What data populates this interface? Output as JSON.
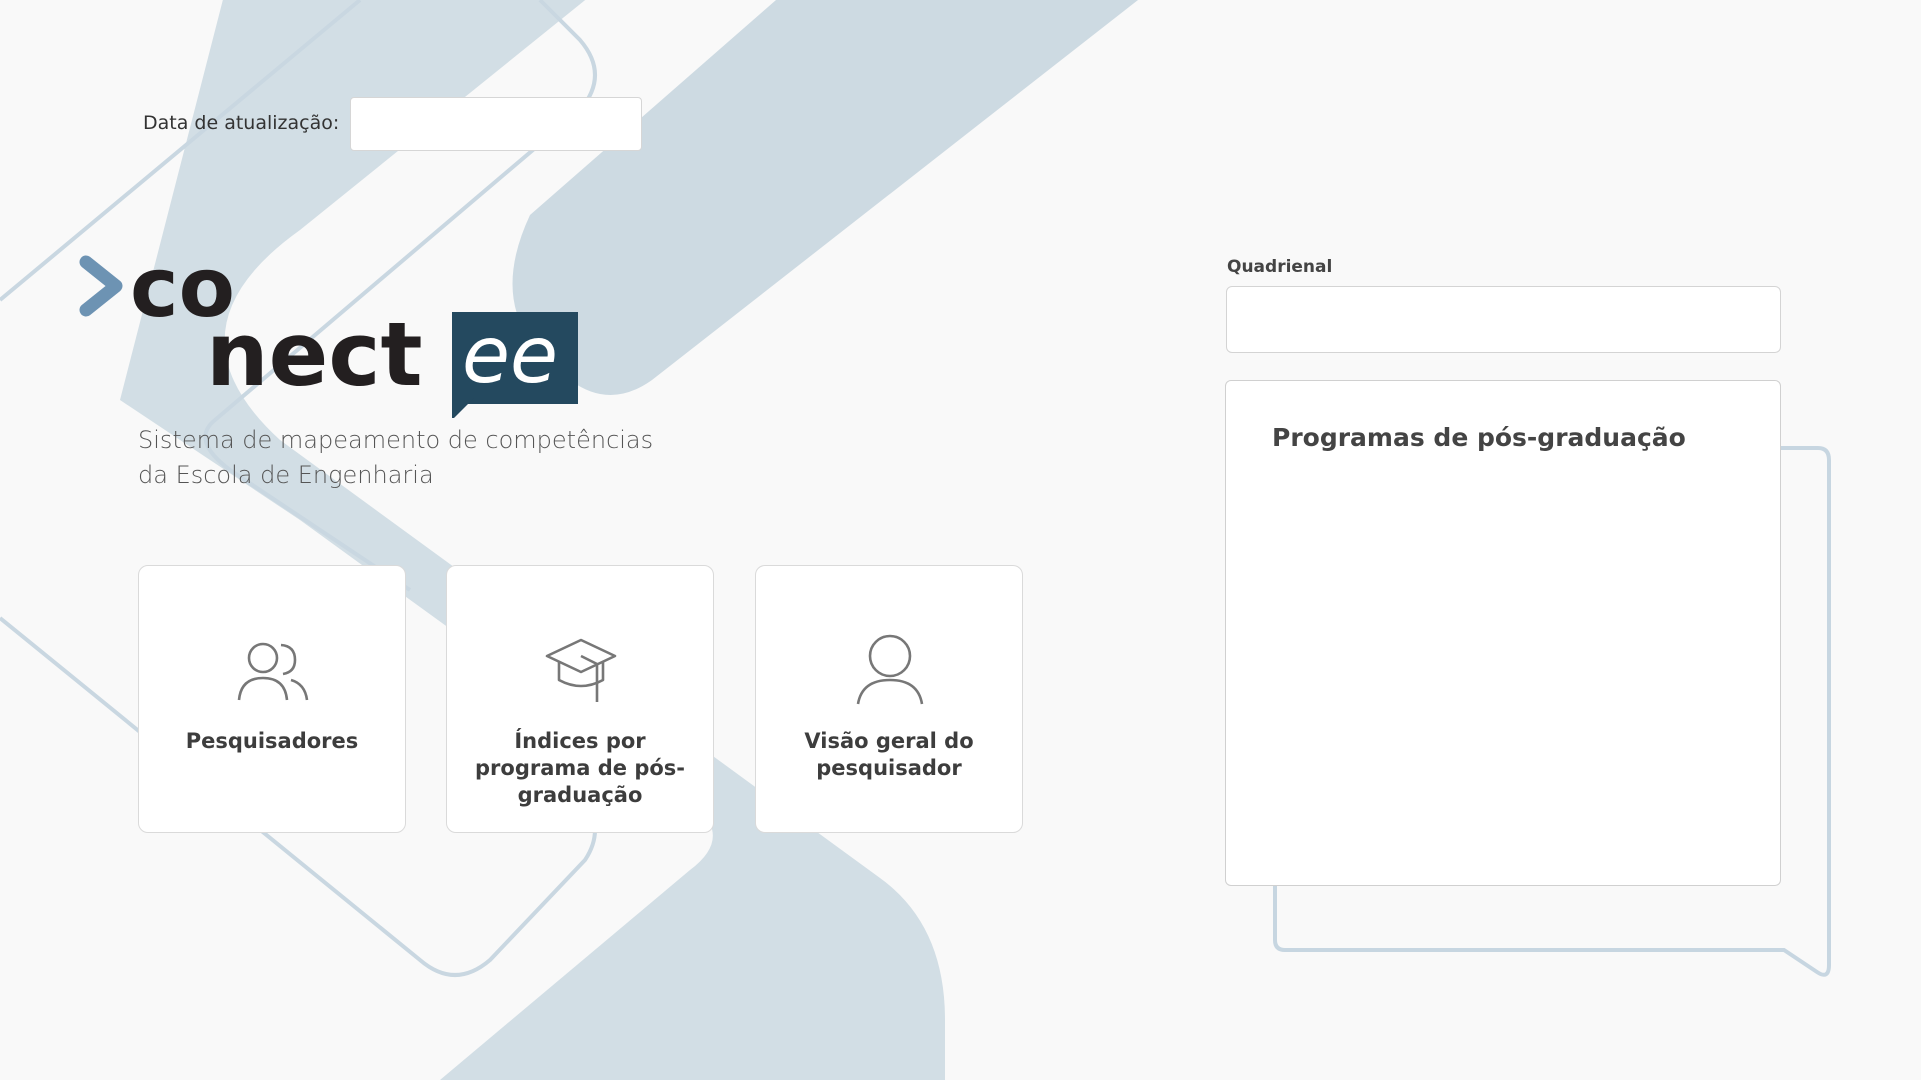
{
  "header": {
    "update_label": "Data de atualização:",
    "update_value": ""
  },
  "brand": {
    "logo_text_1": "co",
    "logo_text_2": "nect",
    "logo_text_3": "ee",
    "tagline_line1": "Sistema de mapeamento de competências",
    "tagline_line2": "da Escola de Engenharia",
    "colors": {
      "dark": "#231f20",
      "blue": "#6d93b3",
      "navy": "#24495f"
    }
  },
  "cards": [
    {
      "label": "Pesquisadores",
      "icon": "users-icon"
    },
    {
      "label": "Índices por programa de pós-graduação",
      "icon": "graduation-cap-icon"
    },
    {
      "label": "Visão geral do pesquisador",
      "icon": "user-icon"
    }
  ],
  "filter": {
    "quadrienal_label": "Quadrienal",
    "quadrienal_value": ""
  },
  "programs": {
    "title": "Programas de pós-graduação"
  },
  "theme": {
    "background": "#f9f9f9",
    "decor_fill": "#cddae2",
    "decor_stroke": "#c9d7e1"
  }
}
